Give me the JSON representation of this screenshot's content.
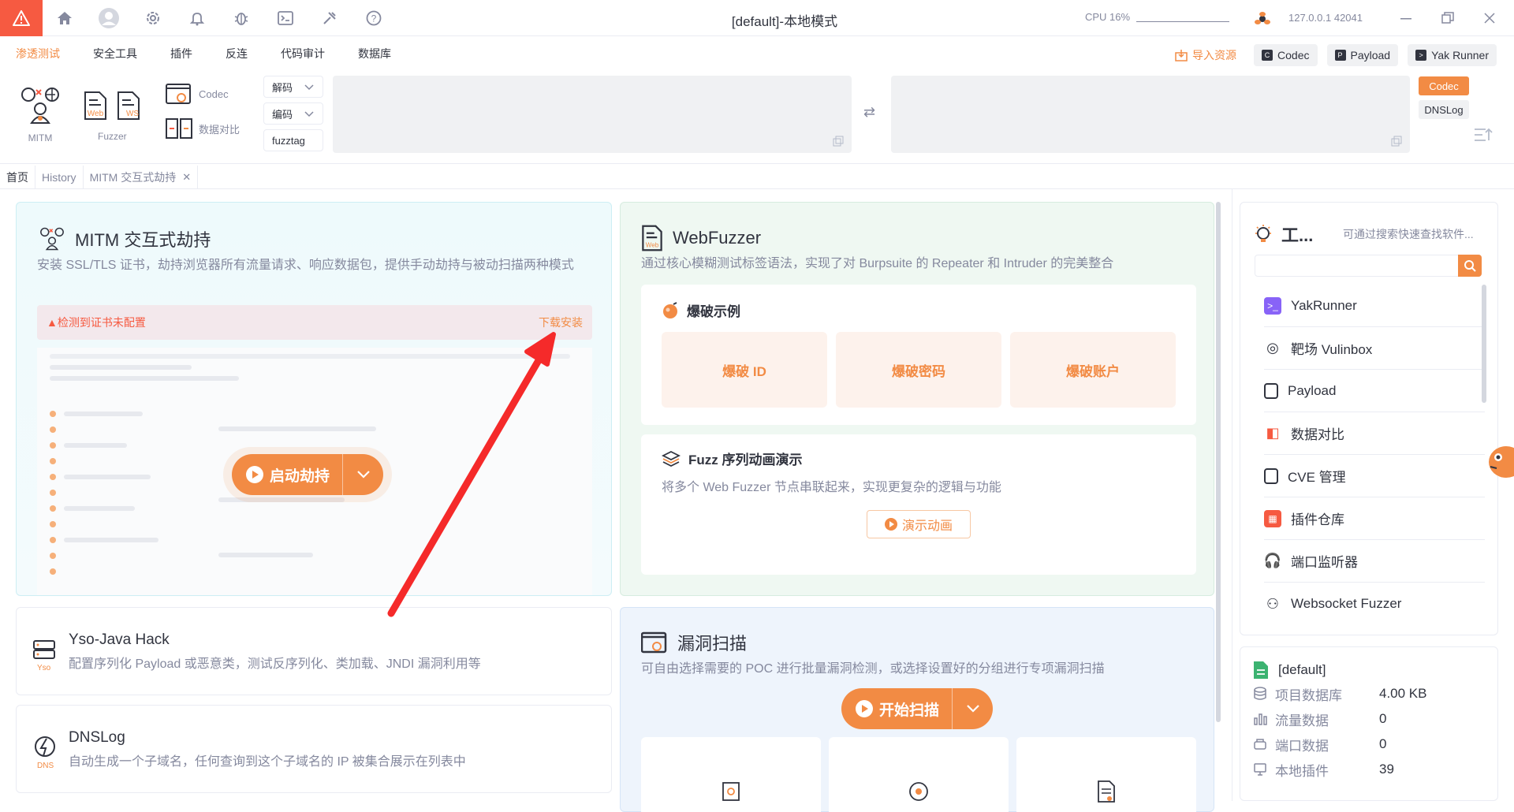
{
  "titlebar": {
    "title": "[default]-本地模式",
    "cpu_label": "CPU 16%",
    "host": "127.0.0.1",
    "port": "42041"
  },
  "menu": {
    "items": [
      "渗透测试",
      "安全工具",
      "插件",
      "反连",
      "代码审计",
      "数据库"
    ],
    "import_label": "导入资源",
    "codec_label": "Codec",
    "payload_label": "Payload",
    "yakrunner_label": "Yak Runner"
  },
  "toolstrip": {
    "mitm_label": "MITM",
    "fuzzer_label": "Fuzzer",
    "web_tag": "Web",
    "ws_tag": "WS",
    "codec_label": "Codec",
    "datacompare_label": "数据对比",
    "decode_label": "解码",
    "encode_label": "编码",
    "fuzztag_label": "fuzztag",
    "side_codec": "Codec",
    "side_dnslog": "DNSLog"
  },
  "pagetabs": {
    "home": "首页",
    "history": "History",
    "mitm": "MITM 交互式劫持"
  },
  "mitm_card": {
    "title": "MITM 交互式劫持",
    "desc": "安装 SSL/TLS 证书，劫持浏览器所有流量请求、响应数据包，提供手动劫持与被动扫描两种模式",
    "warning": "检测到证书未配置",
    "install_link": "下载安装",
    "start_label": "启动劫持"
  },
  "webfuzzer_card": {
    "title": "WebFuzzer",
    "desc": "通过核心模糊测试标签语法，实现了对 Burpsuite 的 Repeater 和 Intruder 的完美整合",
    "burst_title": "爆破示例",
    "burst_buttons": [
      "爆破 ID",
      "爆破密码",
      "爆破账户"
    ],
    "fuzz_title": "Fuzz 序列动画演示",
    "fuzz_desc": "将多个 Web Fuzzer 节点串联起来，实现更复杂的逻辑与功能",
    "demo_label": "演示动画"
  },
  "yso_card": {
    "title": "Yso-Java Hack",
    "desc": "配置序列化 Payload 或恶意类，测试反序列化、类加载、JNDI 漏洞利用等",
    "icon_tag": "Yso"
  },
  "dnslog_card": {
    "title": "DNSLog",
    "desc": "自动生成一个子域名，任何查询到这个子域名的 IP 被集合展示在列表中",
    "icon_tag": "DNS"
  },
  "vuln_card": {
    "title": "漏洞扫描",
    "desc": "可自由选择需要的 POC 进行批量漏洞检测，或选择设置好的分组进行专项漏洞扫描",
    "start_label": "开始扫描"
  },
  "sidebar": {
    "title": "工...",
    "hint": "可通过搜索快速查找软件...",
    "search_value": "",
    "items": [
      "YakRunner",
      "靶场 Vulinbox",
      "Payload",
      "数据对比",
      "CVE 管理",
      "插件仓库",
      "端口监听器",
      "Websocket Fuzzer"
    ]
  },
  "project": {
    "name": "[default]",
    "rows": [
      {
        "label": "项目数据库",
        "value": "4.00 KB"
      },
      {
        "label": "流量数据",
        "value": "0"
      },
      {
        "label": "端口数据",
        "value": "0"
      },
      {
        "label": "本地插件",
        "value": "39"
      }
    ]
  },
  "colors": {
    "accent": "#f28b44",
    "danger": "#f65a41",
    "text": "#31343f",
    "muted": "#85899e"
  }
}
